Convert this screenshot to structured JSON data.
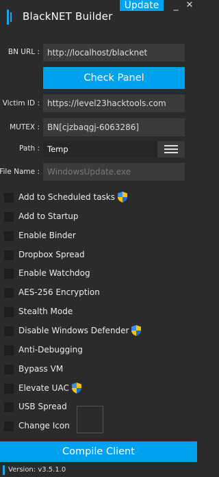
{
  "window": {
    "title": "BlackNET Builder",
    "update_label": "Update",
    "minimize_glyph": "_",
    "close_glyph": "✕"
  },
  "form": {
    "bn_url": {
      "label": "BN URL :",
      "value": "http://localhost/blacknet"
    },
    "check_panel_label": "Check Panel",
    "victim_id": {
      "label": "Victim ID :",
      "value": "https://level23hacktools.com"
    },
    "mutex": {
      "label": "MUTEX :",
      "value": "BN[cjzbaqgj-6063286]"
    },
    "path": {
      "label": "Path :",
      "value": "Temp",
      "menu_icon": "hamburger-menu-icon"
    },
    "file_name": {
      "label": "File Name :",
      "placeholder": "WindowsUpdate.exe"
    }
  },
  "options": [
    {
      "label": "Add to Scheduled tasks",
      "checked": false,
      "uac_shield": true
    },
    {
      "label": "Add to Startup",
      "checked": false,
      "uac_shield": false
    },
    {
      "label": "Enable Binder",
      "checked": false,
      "uac_shield": false
    },
    {
      "label": "Dropbox Spread",
      "checked": false,
      "uac_shield": false
    },
    {
      "label": "Enable Watchdog",
      "checked": false,
      "uac_shield": false
    },
    {
      "label": "AES-256 Encryption",
      "checked": false,
      "uac_shield": false
    },
    {
      "label": "Stealth Mode",
      "checked": false,
      "uac_shield": false
    },
    {
      "label": "Disable Windows Defender",
      "checked": false,
      "uac_shield": true
    },
    {
      "label": "Anti-Debugging",
      "checked": false,
      "uac_shield": false
    },
    {
      "label": "Bypass VM",
      "checked": false,
      "uac_shield": false
    },
    {
      "label": "Elevate UAC",
      "checked": false,
      "uac_shield": true
    },
    {
      "label": "USB Spread",
      "checked": false,
      "uac_shield": false
    },
    {
      "label": "Change Icon",
      "checked": false,
      "uac_shield": false
    }
  ],
  "compile_label": "Compile Client",
  "status": {
    "version_text": "Version: v3.5.1.0"
  },
  "colors": {
    "accent": "#00a2ed",
    "background": "#2b2b2b",
    "field": "#3b3b3b"
  }
}
